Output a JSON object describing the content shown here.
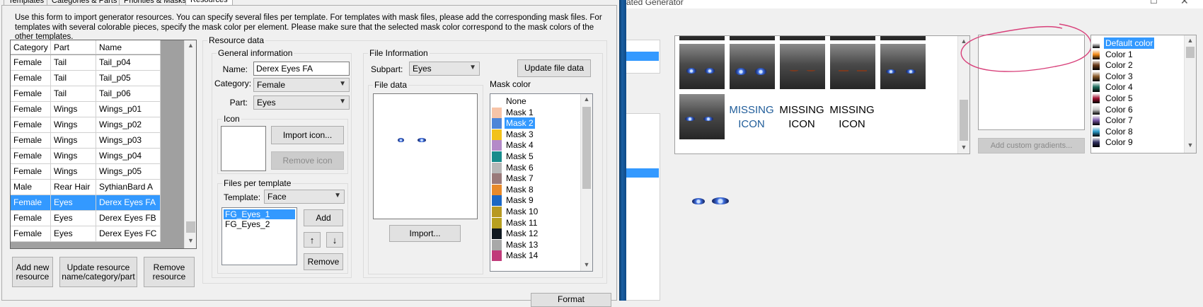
{
  "left": {
    "tabs": [
      "Templates",
      "Categories & Parts",
      "Priorities & Masks",
      "Resources"
    ],
    "instructions": "Use this form to import generator resources. You can specify several files per template. For templates with mask files, please add the corresponding mask files. For templates with several colorable pieces, specify the mask color per element. Please make sure that the selected mask color correspond to the mask colors of the other templates.",
    "table": {
      "headers": [
        "Category",
        "Part",
        "Name"
      ],
      "rows": [
        [
          "Female",
          "Tail",
          "Tail_p04"
        ],
        [
          "Female",
          "Tail",
          "Tail_p05"
        ],
        [
          "Female",
          "Tail",
          "Tail_p06"
        ],
        [
          "Female",
          "Wings",
          "Wings_p01"
        ],
        [
          "Female",
          "Wings",
          "Wings_p02"
        ],
        [
          "Female",
          "Wings",
          "Wings_p03"
        ],
        [
          "Female",
          "Wings",
          "Wings_p04"
        ],
        [
          "Female",
          "Wings",
          "Wings_p05"
        ],
        [
          "Male",
          "Rear Hair",
          "SythianBard A"
        ],
        [
          "Female",
          "Eyes",
          "Derex Eyes FA"
        ],
        [
          "Female",
          "Eyes",
          "Derex Eyes FB"
        ],
        [
          "Female",
          "Eyes",
          "Derex Eyes FC"
        ]
      ],
      "selected_row": 9
    },
    "buttons": {
      "add_new": "Add new resource",
      "update": "Update resource name/category/part",
      "remove": "Remove resource"
    },
    "resource_data": {
      "title": "Resource data",
      "general_info": "General information",
      "name_label": "Name:",
      "name_value": "Derex Eyes FA",
      "category_label": "Category:",
      "category_value": "Female",
      "part_label": "Part:",
      "part_value": "Eyes",
      "icon_label": "Icon",
      "import_icon": "Import icon...",
      "remove_icon": "Remove icon",
      "files_per_template": "Files per template",
      "template_label": "Template:",
      "template_value": "Face",
      "files": [
        "FG_Eyes_1",
        "FG_Eyes_2"
      ],
      "add": "Add",
      "remove": "Remove",
      "up_arrow": "↑",
      "down_arrow": "↓"
    },
    "file_info": {
      "title": "File Information",
      "subpart_label": "Subpart:",
      "subpart_value": "Eyes",
      "update_file_data": "Update file data",
      "file_data_label": "File data",
      "import": "Import...",
      "mask_color_label": "Mask color",
      "masks": [
        {
          "name": "None",
          "color": "#ffffff"
        },
        {
          "name": "Mask 1",
          "color": "#f7c4a8"
        },
        {
          "name": "Mask 2",
          "color": "#4e86d8"
        },
        {
          "name": "Mask 3",
          "color": "#f2c21a"
        },
        {
          "name": "Mask 4",
          "color": "#b48ac8"
        },
        {
          "name": "Mask 5",
          "color": "#188c8c"
        },
        {
          "name": "Mask 6",
          "color": "#b8b8b8"
        },
        {
          "name": "Mask 7",
          "color": "#9a7a7a"
        },
        {
          "name": "Mask 8",
          "color": "#e88a2a"
        },
        {
          "name": "Mask 9",
          "color": "#1c68c4"
        },
        {
          "name": "Mask 10",
          "color": "#b89a22"
        },
        {
          "name": "Mask 11",
          "color": "#b8a020"
        },
        {
          "name": "Mask 12",
          "color": "#101820"
        },
        {
          "name": "Mask 13",
          "color": "#a8a8a8"
        },
        {
          "name": "Mask 14",
          "color": "#c03a7a"
        }
      ],
      "selected_mask": 2
    },
    "partial_button": "Format"
  },
  "right": {
    "title_fragment": "ated Generator",
    "missing_label_1": "MISSING",
    "missing_label_2": "ICON",
    "add_custom_gradients": "Add custom gradients...",
    "colors": [
      {
        "name": "Default color",
        "color": "#ffffff"
      },
      {
        "name": "Color 1",
        "color": "#f28a18"
      },
      {
        "name": "Color 2",
        "color": "#6a3a18"
      },
      {
        "name": "Color 3",
        "color": "#8a5a28"
      },
      {
        "name": "Color 4",
        "color": "#1a6a5a"
      },
      {
        "name": "Color 5",
        "color": "#a01030"
      },
      {
        "name": "Color 6",
        "color": "#c8c8c8"
      },
      {
        "name": "Color 7",
        "color": "#7a58a8"
      },
      {
        "name": "Color 8",
        "color": "#2a9ac8"
      },
      {
        "name": "Color 9",
        "color": "#303060"
      }
    ],
    "selected_color": 0
  }
}
